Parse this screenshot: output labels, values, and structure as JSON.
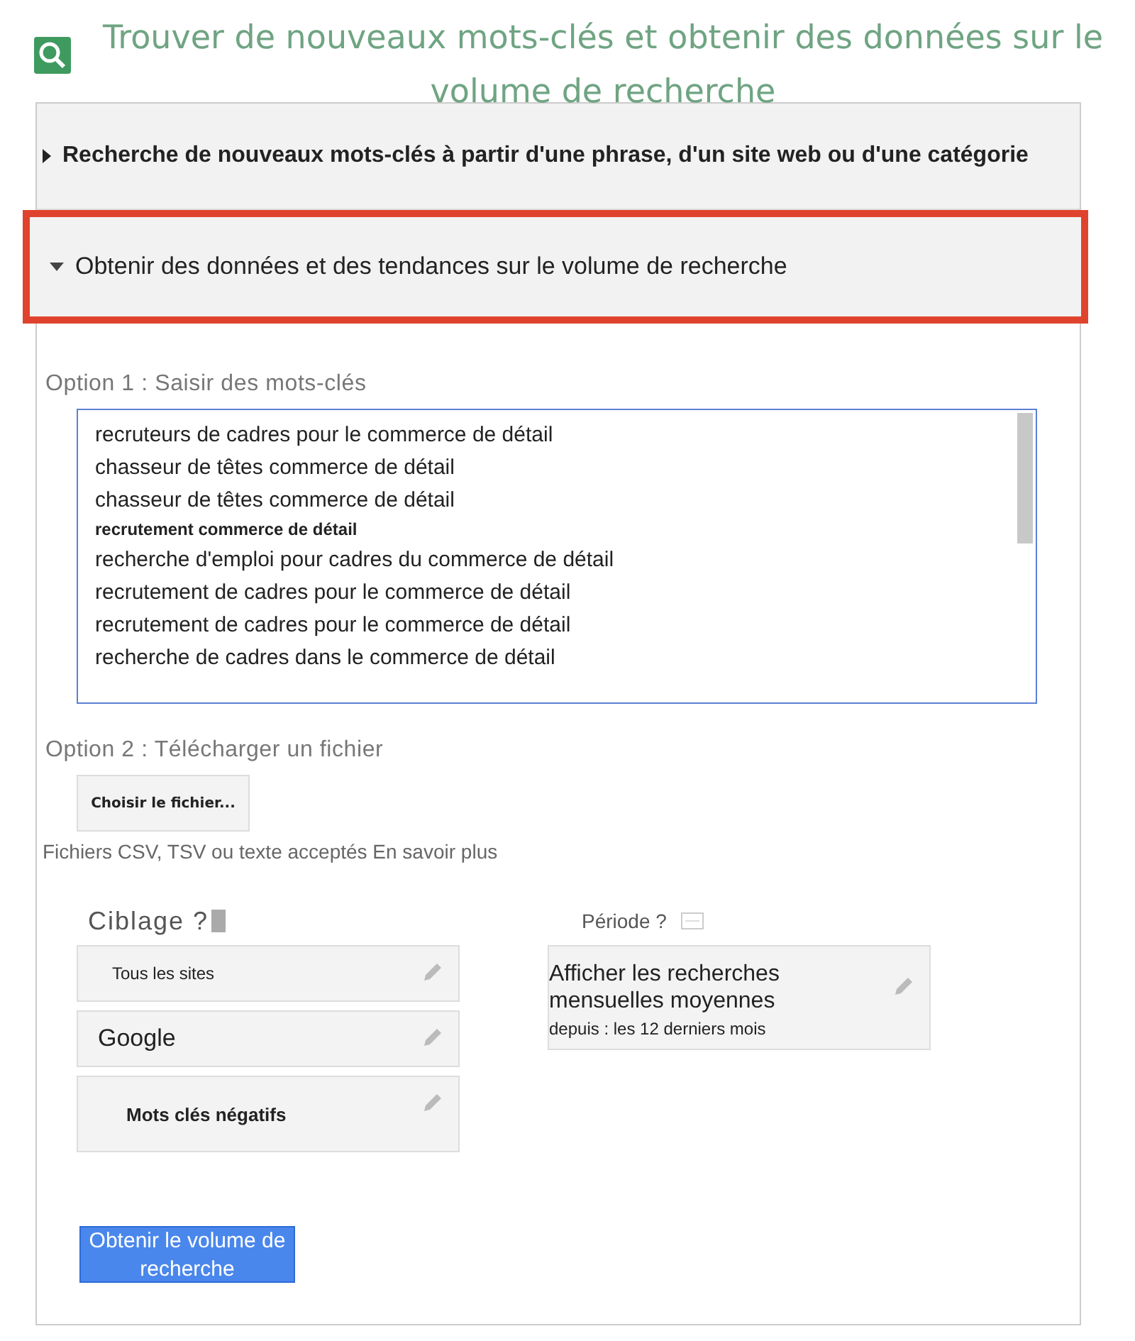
{
  "header": {
    "title": "Trouver de nouveaux mots-clés et obtenir des données sur le volume de recherche"
  },
  "sections": [
    {
      "label": "Recherche de nouveaux mots-clés à partir d'une phrase, d'un site web ou d'une catégorie",
      "expanded": false,
      "highlighted": false
    },
    {
      "label": "Obtenir des données et des tendances sur le volume de recherche",
      "expanded": true,
      "highlighted": true
    }
  ],
  "option1": {
    "label": "Option 1 : Saisir des mots-clés",
    "keywords": [
      {
        "text": "recruteurs de cadres pour le commerce de détail",
        "kind": "plain"
      },
      {
        "text": "chasseur de têtes commerce de détail",
        "kind": "plain"
      },
      {
        "text": "chasseur de têtes commerce de détail",
        "kind": "plain"
      },
      {
        "text": "recrutement commerce de détail",
        "kind": "bold"
      },
      {
        "text": "recherche d'emploi pour cadres du commerce de détail",
        "kind": "plain"
      },
      {
        "text": "recrutement de cadres pour le commerce de détail",
        "kind": "plain"
      },
      {
        "text": "recrutement de cadres pour le commerce de détail",
        "kind": "plain"
      },
      {
        "text": "recherche de cadres dans le commerce de détail",
        "kind": "plain"
      }
    ]
  },
  "option2": {
    "label": "Option 2 : Télécharger un fichier",
    "button": "Choisir le fichier...",
    "hint": "Fichiers CSV, TSV ou texte acceptés En savoir plus"
  },
  "targeting": {
    "label": "Ciblage ?",
    "items": [
      "Tous les sites",
      "Google",
      "Mots clés négatifs"
    ]
  },
  "period": {
    "label": "Période ?",
    "title": "Afficher les recherches mensuelles moyennes",
    "subtitle": "depuis : les 12 derniers mois"
  },
  "submit": "Obtenir le volume de recherche"
}
